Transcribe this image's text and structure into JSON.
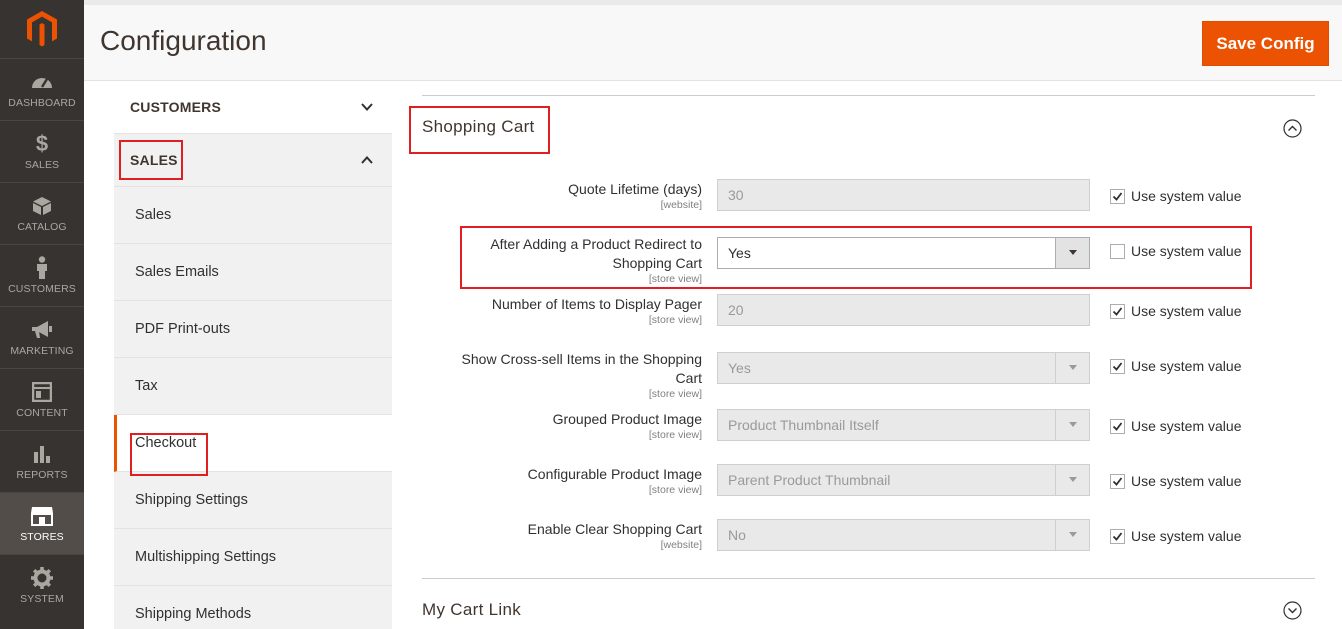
{
  "page": {
    "title": "Configuration",
    "save_label": "Save Config"
  },
  "menu": [
    {
      "label": "DASHBOARD",
      "icon": "dashboard-icon"
    },
    {
      "label": "SALES",
      "icon": "dollar-icon"
    },
    {
      "label": "CATALOG",
      "icon": "cube-icon"
    },
    {
      "label": "CUSTOMERS",
      "icon": "person-icon"
    },
    {
      "label": "MARKETING",
      "icon": "megaphone-icon"
    },
    {
      "label": "CONTENT",
      "icon": "layout-icon"
    },
    {
      "label": "REPORTS",
      "icon": "bar-chart-icon"
    },
    {
      "label": "STORES",
      "icon": "store-icon"
    },
    {
      "label": "SYSTEM",
      "icon": "gear-icon"
    }
  ],
  "tabs": {
    "customers": "CUSTOMERS",
    "sales": "SALES",
    "items": [
      "Sales",
      "Sales Emails",
      "PDF Print-outs",
      "Tax",
      "Checkout",
      "Shipping Settings",
      "Multishipping Settings",
      "Shipping Methods"
    ]
  },
  "section": {
    "title": "Shopping Cart",
    "next_title": "My Cart Link",
    "use_system": "Use system value",
    "rows": [
      {
        "label": "Quote Lifetime (days)",
        "scope": "[website]",
        "value": "30"
      },
      {
        "label1": "After Adding a Product Redirect to",
        "label2": "Shopping Cart",
        "scope": "[store view]",
        "value": "Yes"
      },
      {
        "label": "Number of Items to Display Pager",
        "scope": "[store view]",
        "value": "20"
      },
      {
        "label1": "Show Cross-sell Items in the Shopping",
        "label2": "Cart",
        "scope": "[store view]",
        "value": "Yes"
      },
      {
        "label": "Grouped Product Image",
        "scope": "[store view]",
        "value": "Product Thumbnail Itself"
      },
      {
        "label": "Configurable Product Image",
        "scope": "[store view]",
        "value": "Parent Product Thumbnail"
      },
      {
        "label": "Enable Clear Shopping Cart",
        "scope": "[website]",
        "value": "No"
      }
    ]
  },
  "colors": {
    "accent": "#eb5202",
    "menu_bg": "#373330",
    "annotation": "#e02020"
  }
}
